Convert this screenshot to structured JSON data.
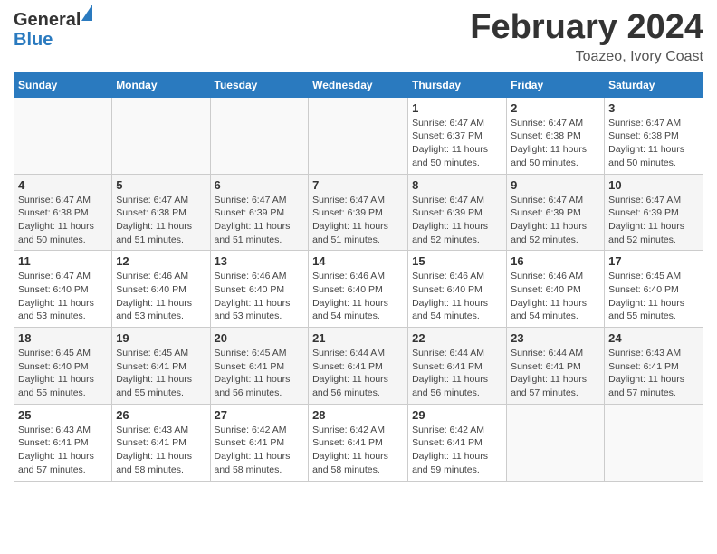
{
  "header": {
    "logo_general": "General",
    "logo_blue": "Blue",
    "month_title": "February 2024",
    "location": "Toazeo, Ivory Coast"
  },
  "days_of_week": [
    "Sunday",
    "Monday",
    "Tuesday",
    "Wednesday",
    "Thursday",
    "Friday",
    "Saturday"
  ],
  "weeks": [
    [
      {
        "num": "",
        "sunrise": "",
        "sunset": "",
        "daylight": "",
        "empty": true
      },
      {
        "num": "",
        "sunrise": "",
        "sunset": "",
        "daylight": "",
        "empty": true
      },
      {
        "num": "",
        "sunrise": "",
        "sunset": "",
        "daylight": "",
        "empty": true
      },
      {
        "num": "",
        "sunrise": "",
        "sunset": "",
        "daylight": "",
        "empty": true
      },
      {
        "num": "1",
        "sunrise": "Sunrise: 6:47 AM",
        "sunset": "Sunset: 6:37 PM",
        "daylight": "Daylight: 11 hours and 50 minutes.",
        "empty": false
      },
      {
        "num": "2",
        "sunrise": "Sunrise: 6:47 AM",
        "sunset": "Sunset: 6:38 PM",
        "daylight": "Daylight: 11 hours and 50 minutes.",
        "empty": false
      },
      {
        "num": "3",
        "sunrise": "Sunrise: 6:47 AM",
        "sunset": "Sunset: 6:38 PM",
        "daylight": "Daylight: 11 hours and 50 minutes.",
        "empty": false
      }
    ],
    [
      {
        "num": "4",
        "sunrise": "Sunrise: 6:47 AM",
        "sunset": "Sunset: 6:38 PM",
        "daylight": "Daylight: 11 hours and 50 minutes.",
        "empty": false
      },
      {
        "num": "5",
        "sunrise": "Sunrise: 6:47 AM",
        "sunset": "Sunset: 6:38 PM",
        "daylight": "Daylight: 11 hours and 51 minutes.",
        "empty": false
      },
      {
        "num": "6",
        "sunrise": "Sunrise: 6:47 AM",
        "sunset": "Sunset: 6:39 PM",
        "daylight": "Daylight: 11 hours and 51 minutes.",
        "empty": false
      },
      {
        "num": "7",
        "sunrise": "Sunrise: 6:47 AM",
        "sunset": "Sunset: 6:39 PM",
        "daylight": "Daylight: 11 hours and 51 minutes.",
        "empty": false
      },
      {
        "num": "8",
        "sunrise": "Sunrise: 6:47 AM",
        "sunset": "Sunset: 6:39 PM",
        "daylight": "Daylight: 11 hours and 52 minutes.",
        "empty": false
      },
      {
        "num": "9",
        "sunrise": "Sunrise: 6:47 AM",
        "sunset": "Sunset: 6:39 PM",
        "daylight": "Daylight: 11 hours and 52 minutes.",
        "empty": false
      },
      {
        "num": "10",
        "sunrise": "Sunrise: 6:47 AM",
        "sunset": "Sunset: 6:39 PM",
        "daylight": "Daylight: 11 hours and 52 minutes.",
        "empty": false
      }
    ],
    [
      {
        "num": "11",
        "sunrise": "Sunrise: 6:47 AM",
        "sunset": "Sunset: 6:40 PM",
        "daylight": "Daylight: 11 hours and 53 minutes.",
        "empty": false
      },
      {
        "num": "12",
        "sunrise": "Sunrise: 6:46 AM",
        "sunset": "Sunset: 6:40 PM",
        "daylight": "Daylight: 11 hours and 53 minutes.",
        "empty": false
      },
      {
        "num": "13",
        "sunrise": "Sunrise: 6:46 AM",
        "sunset": "Sunset: 6:40 PM",
        "daylight": "Daylight: 11 hours and 53 minutes.",
        "empty": false
      },
      {
        "num": "14",
        "sunrise": "Sunrise: 6:46 AM",
        "sunset": "Sunset: 6:40 PM",
        "daylight": "Daylight: 11 hours and 54 minutes.",
        "empty": false
      },
      {
        "num": "15",
        "sunrise": "Sunrise: 6:46 AM",
        "sunset": "Sunset: 6:40 PM",
        "daylight": "Daylight: 11 hours and 54 minutes.",
        "empty": false
      },
      {
        "num": "16",
        "sunrise": "Sunrise: 6:46 AM",
        "sunset": "Sunset: 6:40 PM",
        "daylight": "Daylight: 11 hours and 54 minutes.",
        "empty": false
      },
      {
        "num": "17",
        "sunrise": "Sunrise: 6:45 AM",
        "sunset": "Sunset: 6:40 PM",
        "daylight": "Daylight: 11 hours and 55 minutes.",
        "empty": false
      }
    ],
    [
      {
        "num": "18",
        "sunrise": "Sunrise: 6:45 AM",
        "sunset": "Sunset: 6:40 PM",
        "daylight": "Daylight: 11 hours and 55 minutes.",
        "empty": false
      },
      {
        "num": "19",
        "sunrise": "Sunrise: 6:45 AM",
        "sunset": "Sunset: 6:41 PM",
        "daylight": "Daylight: 11 hours and 55 minutes.",
        "empty": false
      },
      {
        "num": "20",
        "sunrise": "Sunrise: 6:45 AM",
        "sunset": "Sunset: 6:41 PM",
        "daylight": "Daylight: 11 hours and 56 minutes.",
        "empty": false
      },
      {
        "num": "21",
        "sunrise": "Sunrise: 6:44 AM",
        "sunset": "Sunset: 6:41 PM",
        "daylight": "Daylight: 11 hours and 56 minutes.",
        "empty": false
      },
      {
        "num": "22",
        "sunrise": "Sunrise: 6:44 AM",
        "sunset": "Sunset: 6:41 PM",
        "daylight": "Daylight: 11 hours and 56 minutes.",
        "empty": false
      },
      {
        "num": "23",
        "sunrise": "Sunrise: 6:44 AM",
        "sunset": "Sunset: 6:41 PM",
        "daylight": "Daylight: 11 hours and 57 minutes.",
        "empty": false
      },
      {
        "num": "24",
        "sunrise": "Sunrise: 6:43 AM",
        "sunset": "Sunset: 6:41 PM",
        "daylight": "Daylight: 11 hours and 57 minutes.",
        "empty": false
      }
    ],
    [
      {
        "num": "25",
        "sunrise": "Sunrise: 6:43 AM",
        "sunset": "Sunset: 6:41 PM",
        "daylight": "Daylight: 11 hours and 57 minutes.",
        "empty": false
      },
      {
        "num": "26",
        "sunrise": "Sunrise: 6:43 AM",
        "sunset": "Sunset: 6:41 PM",
        "daylight": "Daylight: 11 hours and 58 minutes.",
        "empty": false
      },
      {
        "num": "27",
        "sunrise": "Sunrise: 6:42 AM",
        "sunset": "Sunset: 6:41 PM",
        "daylight": "Daylight: 11 hours and 58 minutes.",
        "empty": false
      },
      {
        "num": "28",
        "sunrise": "Sunrise: 6:42 AM",
        "sunset": "Sunset: 6:41 PM",
        "daylight": "Daylight: 11 hours and 58 minutes.",
        "empty": false
      },
      {
        "num": "29",
        "sunrise": "Sunrise: 6:42 AM",
        "sunset": "Sunset: 6:41 PM",
        "daylight": "Daylight: 11 hours and 59 minutes.",
        "empty": false
      },
      {
        "num": "",
        "sunrise": "",
        "sunset": "",
        "daylight": "",
        "empty": true
      },
      {
        "num": "",
        "sunrise": "",
        "sunset": "",
        "daylight": "",
        "empty": true
      }
    ]
  ]
}
